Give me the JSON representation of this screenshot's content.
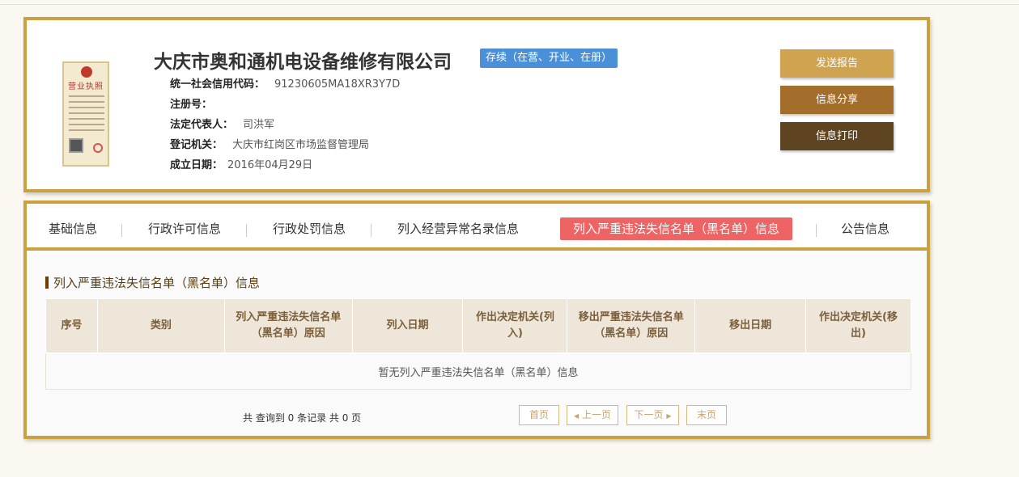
{
  "company": {
    "name": "大庆市奥和通机电设备维修有限公司",
    "status": "存续（在营、开业、在册）",
    "license_title": "营业执照"
  },
  "info": {
    "credit_code_label": "统一社会信用代码：",
    "credit_code": "91230605MA18XR3Y7D",
    "reg_no_label": "注册号：",
    "reg_no": "",
    "legal_rep_label": "法定代表人：",
    "legal_rep": "司洪军",
    "authority_label": "登记机关：",
    "authority": "大庆市红岗区市场监督管理局",
    "founded_label": "成立日期：",
    "founded": "2016年04月29日"
  },
  "actions": {
    "report": "发送报告",
    "share": "信息分享",
    "print": "信息打印"
  },
  "tabs": [
    {
      "label": "基础信息"
    },
    {
      "label": "行政许可信息"
    },
    {
      "label": "行政处罚信息"
    },
    {
      "label": "列入经营异常名录信息"
    },
    {
      "label": "列入严重违法失信名单（黑名单）信息",
      "active": true
    },
    {
      "label": "公告信息"
    }
  ],
  "section": {
    "title": "列入严重违法失信名单（黑名单）信息"
  },
  "table": {
    "columns": [
      "序号",
      "类别",
      "列入严重违法失信名单（黑名单）原因",
      "列入日期",
      "作出决定机关(列入)",
      "移出严重违法失信名单（黑名单）原因",
      "移出日期",
      "作出决定机关(移出)"
    ],
    "empty_message": "暂无列入严重违法失信名单（黑名单）信息"
  },
  "pager": {
    "summary": "共 查询到 0 条记录 共 0 页",
    "first": "首页",
    "prev": "上一页",
    "next": "下一页",
    "last": "末页"
  },
  "colors": {
    "border": "#c9a13f",
    "active_tab": "#ee6464",
    "status_badge": "#4a90d9",
    "btn_report": "#cfa34f",
    "btn_share": "#a36e2c",
    "btn_print": "#5e4420"
  }
}
